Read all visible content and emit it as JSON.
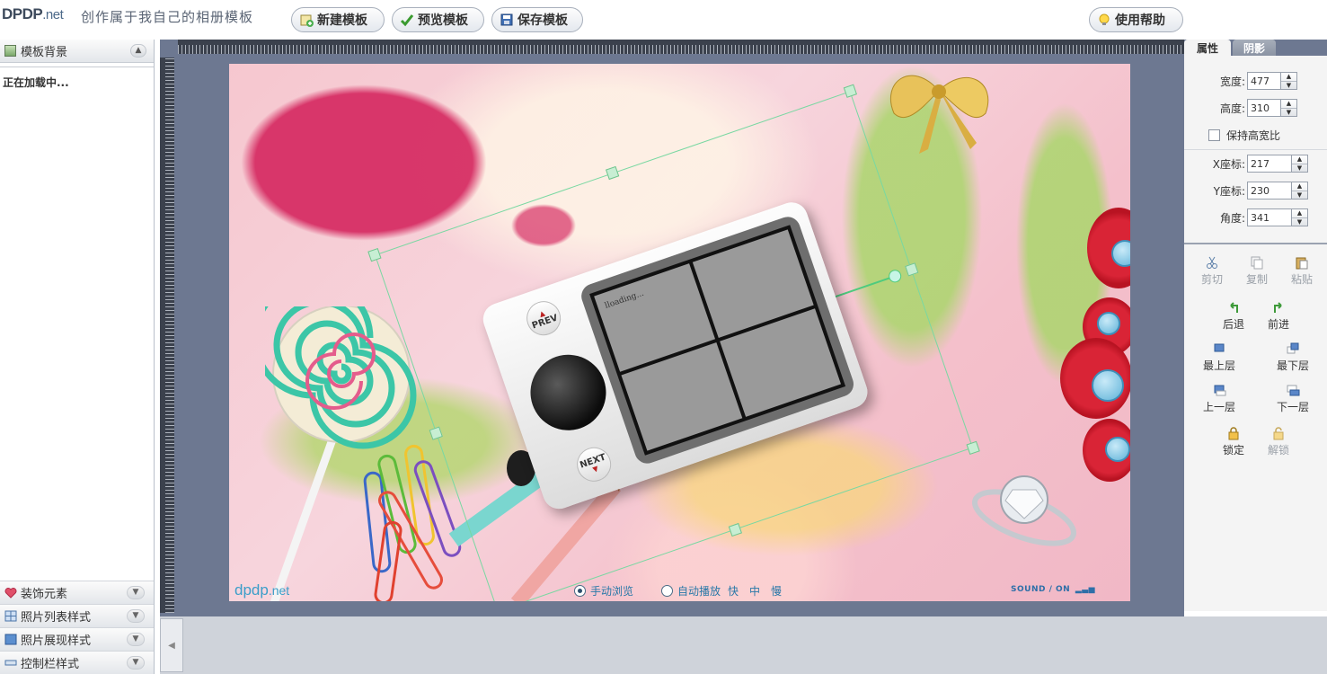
{
  "header": {
    "logo": "DPDP",
    "logo_suffix": ".net",
    "tagline": "创作属于我自己的相册模板",
    "buttons": {
      "new_template": "新建模板",
      "preview_template": "预览模板",
      "save_template": "保存模板",
      "help": "使用帮助"
    }
  },
  "left_panel": {
    "section_title": "模板背景",
    "loading_text": "正在加载中...",
    "accordion": [
      {
        "label": "装饰元素",
        "icon": "heart-icon"
      },
      {
        "label": "照片列表样式",
        "icon": "grid-icon"
      },
      {
        "label": "照片展现样式",
        "icon": "square-icon"
      },
      {
        "label": "控制栏样式",
        "icon": "bar-icon"
      }
    ]
  },
  "stage": {
    "player_loading": "lloading...",
    "prev_label": "PREV",
    "next_label": "NEXT",
    "footer_logo": "dpdp",
    "footer_logo_suffix": ".net",
    "manual_browse": "手动浏览",
    "auto_play": "自动播放",
    "speeds": [
      "快",
      "中",
      "慢"
    ],
    "sound_label": "SOUND / ON"
  },
  "right_panel": {
    "tabs": {
      "properties": "属性",
      "shadow": "阴影"
    },
    "fields": {
      "width": {
        "label": "宽度:",
        "value": "477"
      },
      "height": {
        "label": "高度:",
        "value": "310"
      },
      "keep_ratio": "保持高宽比",
      "x": {
        "label": "X座标:",
        "value": "217"
      },
      "y": {
        "label": "Y座标:",
        "value": "230"
      },
      "angle": {
        "label": "角度:",
        "value": "341"
      }
    },
    "tools": {
      "cut": "剪切",
      "copy": "复制",
      "paste": "粘贴",
      "undo": "后退",
      "redo": "前进",
      "bring_to_front": "最上层",
      "send_to_back": "最下层",
      "bring_forward": "上一层",
      "send_backward": "下一层",
      "lock": "锁定",
      "unlock": "解锁"
    }
  },
  "colors": {
    "workspace": "#6d7891",
    "splash_red": "#d62e64",
    "accent_blue": "#2878a8"
  }
}
